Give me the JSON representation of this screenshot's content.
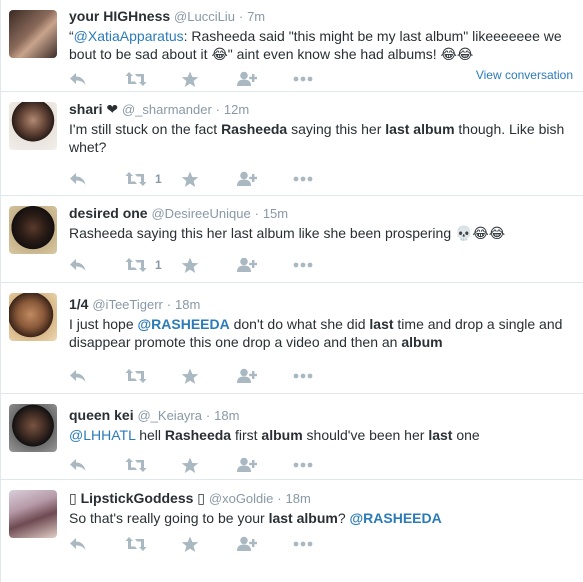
{
  "tweets": [
    {
      "fullname": "your HIGHness",
      "username": "@LucciLiu",
      "time": "7m",
      "text_parts": [
        {
          "t": "“",
          "s": "plain"
        },
        {
          "t": "@XatiaApparatus",
          "s": "link"
        },
        {
          "t": ": Rasheeda said \"this might be my last album\" likeeeeeee we bout to be sad about it 😂\" aint even know she had albums! 😂😂",
          "s": "plain"
        }
      ],
      "retweets": "",
      "view_conversation": "View conversation"
    },
    {
      "fullname": "shari ❤",
      "username": "@_sharmander",
      "time": "12m",
      "text_parts": [
        {
          "t": "I'm still stuck on the fact ",
          "s": "plain"
        },
        {
          "t": "Rasheeda",
          "s": "bold"
        },
        {
          "t": " saying this her ",
          "s": "plain"
        },
        {
          "t": "last album",
          "s": "bold"
        },
        {
          "t": " though. Like bish whet?",
          "s": "plain"
        }
      ],
      "retweets": "1"
    },
    {
      "fullname": "desired one",
      "username": "@DesireeUnique",
      "time": "15m",
      "text_parts": [
        {
          "t": "Rasheeda saying this her last album like she been prospering 💀😂😂",
          "s": "plain"
        }
      ],
      "retweets": "1"
    },
    {
      "fullname": "1/4",
      "username": "@iTeeTigerr",
      "time": "18m",
      "text_parts": [
        {
          "t": "I just hope ",
          "s": "plain"
        },
        {
          "t": "@RASHEEDA",
          "s": "linkbold"
        },
        {
          "t": " don't do what she did ",
          "s": "plain"
        },
        {
          "t": "last",
          "s": "bold"
        },
        {
          "t": " time and drop a single and disappear promote this one drop a video and then an ",
          "s": "plain"
        },
        {
          "t": "album",
          "s": "bold"
        }
      ],
      "retweets": ""
    },
    {
      "fullname": "queen kei",
      "username": "@_Keiayra",
      "time": "18m",
      "text_parts": [
        {
          "t": "@LHHATL",
          "s": "link"
        },
        {
          "t": " hell ",
          "s": "plain"
        },
        {
          "t": "Rasheeda",
          "s": "bold"
        },
        {
          "t": " first ",
          "s": "plain"
        },
        {
          "t": "album",
          "s": "bold"
        },
        {
          "t": " should've been her ",
          "s": "plain"
        },
        {
          "t": "last",
          "s": "bold"
        },
        {
          "t": " one",
          "s": "plain"
        }
      ],
      "retweets": ""
    },
    {
      "fullname": "▯ LipstickGoddess ▯",
      "username": "@xoGoldie",
      "time": "18m",
      "text_parts": [
        {
          "t": "So that's really going to be your ",
          "s": "plain"
        },
        {
          "t": "last album",
          "s": "bold"
        },
        {
          "t": "? ",
          "s": "plain"
        },
        {
          "t": "@RASHEEDA",
          "s": "linkbold"
        }
      ],
      "retweets": ""
    }
  ],
  "colors": {
    "link": "#2b7bb9",
    "icon": "#aab8c2",
    "muted": "#8899a6",
    "text": "#292f33",
    "border": "#e1e8ed"
  },
  "icons": [
    "reply-icon",
    "retweet-icon",
    "favorite-icon",
    "follow-icon",
    "more-icon"
  ]
}
